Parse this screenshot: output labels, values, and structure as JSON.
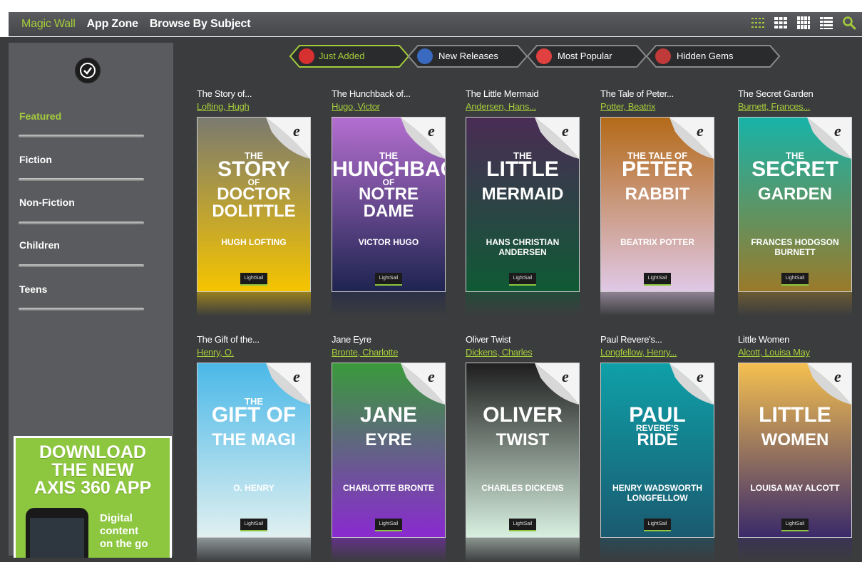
{
  "nav": {
    "items": [
      "Magic Wall",
      "App Zone",
      "Browse By Subject"
    ],
    "active": "Magic Wall",
    "view_icons": [
      "grid-small-icon",
      "grid-medium-icon",
      "grid-large-icon",
      "list-icon",
      "search-icon"
    ]
  },
  "sidebar": {
    "categories": [
      "Featured",
      "Fiction",
      "Non-Fiction",
      "Children",
      "Teens"
    ],
    "active": "Featured",
    "ad": {
      "headline": [
        "DOWNLOAD",
        "THE NEW",
        "AXIS 360 APP"
      ],
      "sub": [
        "Digital",
        "content",
        "on the go"
      ]
    }
  },
  "tabs": [
    {
      "label": "Just Added",
      "icon": "just-added-icon",
      "active": true
    },
    {
      "label": "New Releases",
      "icon": "new-releases-icon",
      "active": false
    },
    {
      "label": "Most Popular",
      "icon": "heart-icon",
      "active": false
    },
    {
      "label": "Hidden Gems",
      "icon": "gem-icon",
      "active": false
    }
  ],
  "books": [
    {
      "title": "The Story of...",
      "author": "Lofting, Hugh",
      "cover": [
        "THE",
        "STORY",
        "OF",
        "DOCTOR DOLITTLE",
        "HUGH LOFTING"
      ],
      "colors": [
        "#7a7a70",
        "#f5c400"
      ]
    },
    {
      "title": "The Hunchback of...",
      "author": "Hugo, Victor",
      "cover": [
        "THE",
        "HUNCHBACK",
        "OF",
        "NOTRE DAME",
        "VICTOR HUGO"
      ],
      "colors": [
        "#b46fd0",
        "#1e2450"
      ]
    },
    {
      "title": "The Little Mermaid",
      "author": "Andersen, Hans...",
      "cover": [
        "THE",
        "LITTLE",
        "",
        "MERMAID",
        "HANS CHRISTIAN ANDERSEN"
      ],
      "colors": [
        "#4a2c55",
        "#0f5a35"
      ]
    },
    {
      "title": "The Tale of Peter...",
      "author": "Potter, Beatrix",
      "cover": [
        "THE TALE OF",
        "PETER",
        "",
        "RABBIT",
        "BEATRIX POTTER"
      ],
      "colors": [
        "#b46a18",
        "#e0c8e6"
      ]
    },
    {
      "title": "The Secret Garden",
      "author": "Burnett, Frances...",
      "cover": [
        "THE",
        "SECRET",
        "",
        "GARDEN",
        "FRANCES HODGSON BURNETT"
      ],
      "colors": [
        "#17b3a8",
        "#9a7a2a"
      ]
    },
    {
      "title": "The Gift of the...",
      "author": "Henry, O.",
      "cover": [
        "THE",
        "GIFT OF",
        "",
        "THE MAGI",
        "O. HENRY"
      ],
      "colors": [
        "#4ab8e8",
        "#e0f0f0"
      ]
    },
    {
      "title": "Jane Eyre",
      "author": "Bronte, Charlotte",
      "cover": [
        "",
        "JANE",
        "",
        "EYRE",
        "CHARLOTTE BRONTE"
      ],
      "colors": [
        "#3a9a3a",
        "#8a2ad0"
      ]
    },
    {
      "title": "Oliver Twist",
      "author": "Dickens, Charles",
      "cover": [
        "",
        "OLIVER",
        "",
        "TWIST",
        "CHARLES DICKENS"
      ],
      "colors": [
        "#1e1e1e",
        "#d8f0e0"
      ]
    },
    {
      "title": "Paul Revere's...",
      "author": "Longfellow, Henry...",
      "cover": [
        "",
        "PAUL",
        "REVERE'S",
        "RIDE",
        "HENRY WADSWORTH LONGFELLOW"
      ],
      "colors": [
        "#0fa0a8",
        "#1a5a70"
      ]
    },
    {
      "title": "Little Women",
      "author": "Alcott, Louisa May",
      "cover": [
        "",
        "LITTLE",
        "",
        "WOMEN",
        "LOUISA MAY ALCOTT"
      ],
      "colors": [
        "#f5c050",
        "#3a2a6a"
      ]
    }
  ],
  "cover_logo": "LightSail",
  "cover_badge": "e"
}
